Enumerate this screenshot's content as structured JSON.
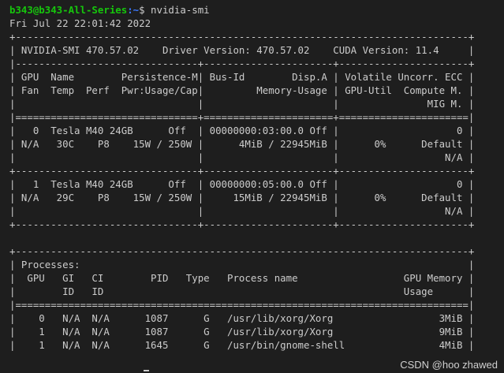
{
  "prompt": {
    "user_host": "b343@b343-All-Series",
    "path": ":~",
    "symbol": "$ ",
    "command": "nvidia-smi"
  },
  "output_lines": [
    "Fri Jul 22 22:01:42 2022",
    "+-----------------------------------------------------------------------------+",
    "| NVIDIA-SMI 470.57.02    Driver Version: 470.57.02    CUDA Version: 11.4     |",
    "|-------------------------------+----------------------+----------------------+",
    "| GPU  Name        Persistence-M| Bus-Id        Disp.A | Volatile Uncorr. ECC |",
    "| Fan  Temp  Perf  Pwr:Usage/Cap|         Memory-Usage | GPU-Util  Compute M. |",
    "|                               |                      |               MIG M. |",
    "|===============================+======================+======================|",
    "|   0  Tesla M40 24GB      Off  | 00000000:03:00.0 Off |                    0 |",
    "| N/A   30C    P8    15W / 250W |      4MiB / 22945MiB |      0%      Default |",
    "|                               |                      |                  N/A |",
    "+-------------------------------+----------------------+----------------------+",
    "|   1  Tesla M40 24GB      Off  | 00000000:05:00.0 Off |                    0 |",
    "| N/A   29C    P8    15W / 250W |     15MiB / 22945MiB |      0%      Default |",
    "|                               |                      |                  N/A |",
    "+-------------------------------+----------------------+----------------------+",
    "",
    "+-----------------------------------------------------------------------------+",
    "| Processes:                                                                  |",
    "|  GPU   GI   CI        PID   Type   Process name                  GPU Memory |",
    "|        ID   ID                                                   Usage      |",
    "|=============================================================================|",
    "|    0   N/A  N/A      1087      G   /usr/lib/xorg/Xorg                  3MiB |",
    "|    1   N/A  N/A      1087      G   /usr/lib/xorg/Xorg                  9MiB |",
    "|    1   N/A  N/A      1645      G   /usr/bin/gnome-shell                4MiB |"
  ],
  "watermark": "CSDN @hoo zhawed",
  "colors": {
    "background": "#1e1e1e",
    "text": "#cccccc",
    "user_host": "#16c60c",
    "path": "#3b78ff"
  }
}
